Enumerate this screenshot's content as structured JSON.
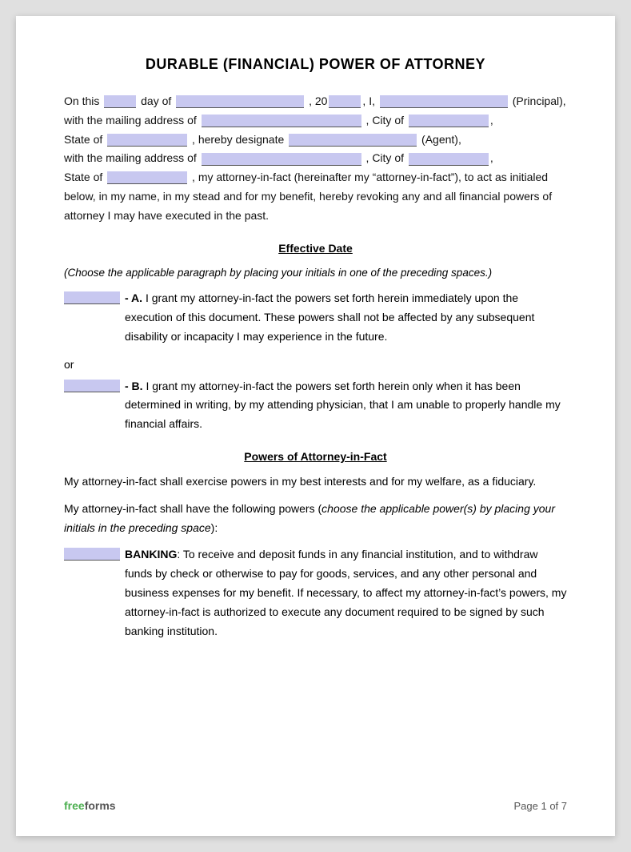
{
  "title": "DURABLE (FINANCIAL) POWER OF ATTORNEY",
  "intro": {
    "line1_pre": "On this",
    "line1_day_field": "",
    "line1_mid1": "day of",
    "line1_date_field": "",
    "line1_year_pre": ", 20",
    "line1_year_field": "",
    "line1_mid2": ", I,",
    "line1_principal_field": "",
    "line1_post": "(Principal),",
    "line2_pre": "with the mailing address of",
    "line2_address_field": "",
    "line2_city_pre": ", City of",
    "line2_city_field": "",
    "line3_pre": "State of",
    "line3_state_field": "",
    "line3_mid": ", hereby designate",
    "line3_agent_field": "",
    "line3_post": "(Agent),",
    "line4_pre": "with the mailing address of",
    "line4_address_field": "",
    "line4_city_pre": ", City of",
    "line4_city_field": "",
    "line5_pre": "State of",
    "line5_state_field": "",
    "line5_post": ", my attorney-in-fact (hereinafter my “attorney-in-fact”), to act as initialed below, in my name, in my stead and for my benefit, hereby revoking any and all financial powers of attorney I may have executed in the past."
  },
  "effective_date": {
    "heading": "Effective Date",
    "note": "(Choose the applicable paragraph by placing your initials in one of the preceding spaces.)",
    "option_a_label": "- A.",
    "option_a_text": "I grant my attorney-in-fact the powers set forth herein immediately upon the execution of this document. These powers shall not be affected by any subsequent disability or incapacity I may experience in the future.",
    "or_text": "or",
    "option_b_label": "- B.",
    "option_b_text": "I grant my attorney-in-fact the powers set forth herein only when it has been determined in writing, by my attending physician, that I am unable to properly handle my financial affairs."
  },
  "powers_section": {
    "heading": "Powers of Attorney-in-Fact",
    "para1": "My attorney-in-fact shall exercise powers in my best interests and for my welfare, as a fiduciary.",
    "para2_pre": "My attorney-in-fact shall have the following powers (",
    "para2_italic": "choose the applicable power(s) by placing your initials in the preceding space",
    "para2_post": "):",
    "banking_label": "BANKING",
    "banking_text": ": To receive and deposit funds in any financial institution, and to withdraw funds by check or otherwise to pay for goods, services, and any other personal and business expenses for my benefit.  If necessary, to affect my attorney-in-fact’s powers, my attorney-in-fact is authorized to execute any document required to be signed by such banking institution."
  },
  "footer": {
    "brand_free": "free",
    "brand_forms": "forms",
    "page_label": "Page 1 of 7"
  }
}
